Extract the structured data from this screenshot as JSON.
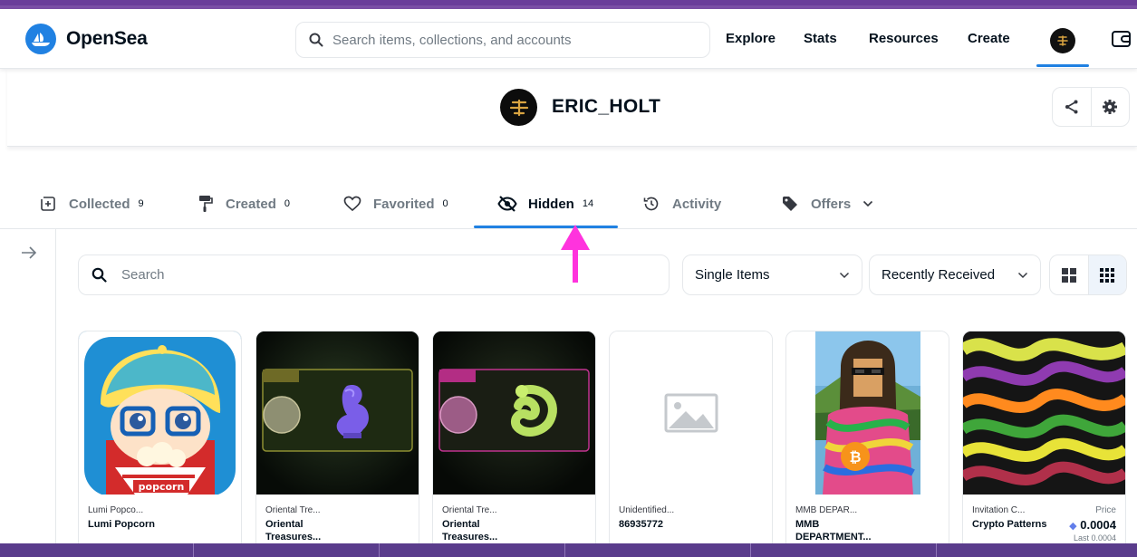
{
  "navbar": {
    "brand": "OpenSea",
    "search_placeholder": "Search items, collections, and accounts",
    "links": [
      "Explore",
      "Stats",
      "Resources",
      "Create"
    ],
    "accent_color": "#2081e2"
  },
  "profile": {
    "username": "ERIC_HOLT"
  },
  "tabs": [
    {
      "label": "Collected",
      "count": "9"
    },
    {
      "label": "Created",
      "count": "0"
    },
    {
      "label": "Favorited",
      "count": "0"
    },
    {
      "label": "Hidden",
      "count": "14"
    },
    {
      "label": "Activity",
      "count": ""
    },
    {
      "label": "Offers",
      "count": ""
    }
  ],
  "active_tab": "Hidden",
  "filters": {
    "search_placeholder": "Search",
    "item_type": "Single Items",
    "sort": "Recently Received"
  },
  "cards": [
    {
      "collection": "Lumi Popco...",
      "name": "Lumi Popcorn",
      "image_text": "popcorn"
    },
    {
      "collection": "Oriental Tre...",
      "name": "Oriental Treasures..."
    },
    {
      "collection": "Oriental Tre...",
      "name": "Oriental Treasures..."
    },
    {
      "collection": "Unidentified...",
      "name": "86935772"
    },
    {
      "collection": "MMB DEPAR...",
      "name": "MMB DEPARTMENT..."
    },
    {
      "collection": "Invitation C...",
      "name": "Crypto Patterns",
      "price_label": "Price",
      "price": "0.0004",
      "last": "Last 0.0004"
    }
  ]
}
